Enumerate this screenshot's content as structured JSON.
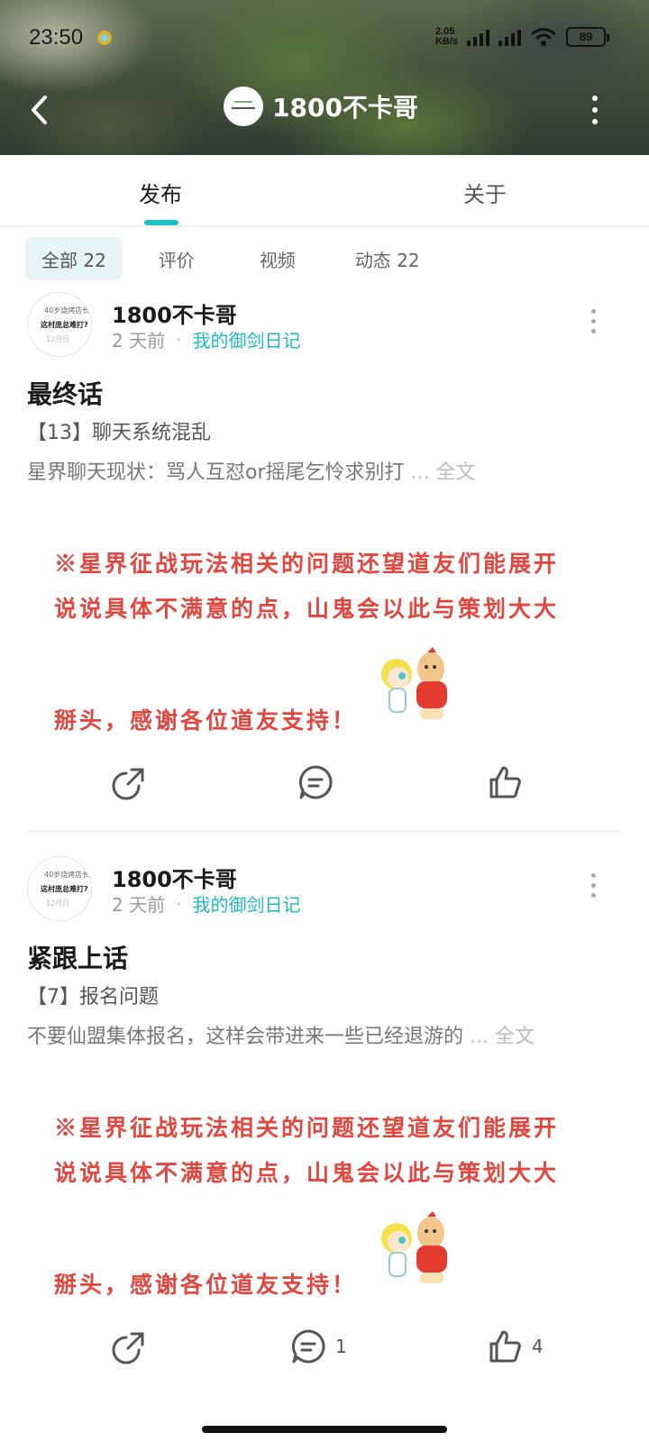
{
  "status_bar": {
    "time": "23:50",
    "net_speed_top": "2.05",
    "net_speed_bottom": "KB/s",
    "battery": "89"
  },
  "nav": {
    "title": "1800不卡哥"
  },
  "tabs": [
    {
      "label": "发布"
    },
    {
      "label": "关于"
    }
  ],
  "filters": [
    {
      "label": "全部 22"
    },
    {
      "label": "评价"
    },
    {
      "label": "视频"
    },
    {
      "label": "动态 22"
    }
  ],
  "posts": [
    {
      "author": "1800不卡哥",
      "time": "2 天前",
      "topic": "我的御剑日记",
      "title": "最终话",
      "subtitle": "【13】聊天系统混乱",
      "excerpt": "星界聊天现状：骂人互怼or摇尾乞怜求别打",
      "ellipsis": "...",
      "full_text_link": "全文",
      "banner_lines": [
        "※星界征战玩法相关的问题还望道友们能展开",
        "说说具体不满意的点，山鬼会以此与策划大大",
        "掰头，感谢各位道友支持！"
      ],
      "comment_count": "",
      "like_count": ""
    },
    {
      "author": "1800不卡哥",
      "time": "2 天前",
      "topic": "我的御剑日记",
      "title": "紧跟上话",
      "subtitle": "【7】报名问题",
      "excerpt": "不要仙盟集体报名，这样会带进来一些已经退游的",
      "ellipsis": "...",
      "full_text_link": "全文",
      "banner_lines": [
        "※星界征战玩法相关的问题还望道友们能展开",
        "说说具体不满意的点，山鬼会以此与策划大大",
        "掰头，感谢各位道友支持！"
      ],
      "comment_count": "1",
      "like_count": "4"
    }
  ],
  "colors": {
    "accent": "#1fc1c9",
    "topic": "#1fb8c3",
    "banner_text": "#e0473f"
  },
  "icons": [
    "back-icon",
    "more-icon",
    "share-icon",
    "comment-icon",
    "like-icon"
  ]
}
